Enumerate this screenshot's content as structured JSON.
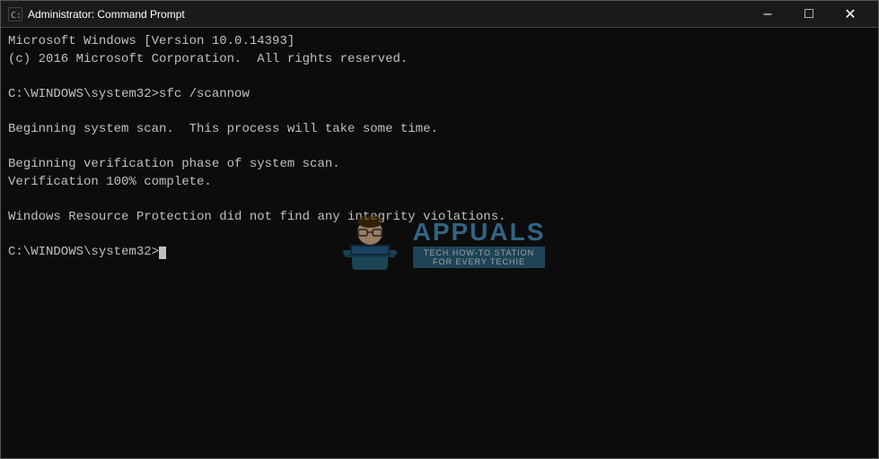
{
  "window": {
    "title": "Administrator: Command Prompt",
    "icon_label": "cmd-icon"
  },
  "titlebar": {
    "minimize_label": "–",
    "maximize_label": "□",
    "close_label": "✕"
  },
  "console": {
    "lines": [
      "Microsoft Windows [Version 10.0.14393]",
      "(c) 2016 Microsoft Corporation.  All rights reserved.",
      "",
      "C:\\WINDOWS\\system32>sfc /scannow",
      "",
      "Beginning system scan.  This process will take some time.",
      "",
      "Beginning verification phase of system scan.",
      "Verification 100% complete.",
      "",
      "Windows Resource Protection did not find any integrity violations.",
      "",
      "C:\\WINDOWS\\system32>"
    ]
  },
  "watermark": {
    "brand": "APPUALS",
    "subtitle": "TECH HOW-TO STATION\nFOR EVERY TECHIE"
  }
}
